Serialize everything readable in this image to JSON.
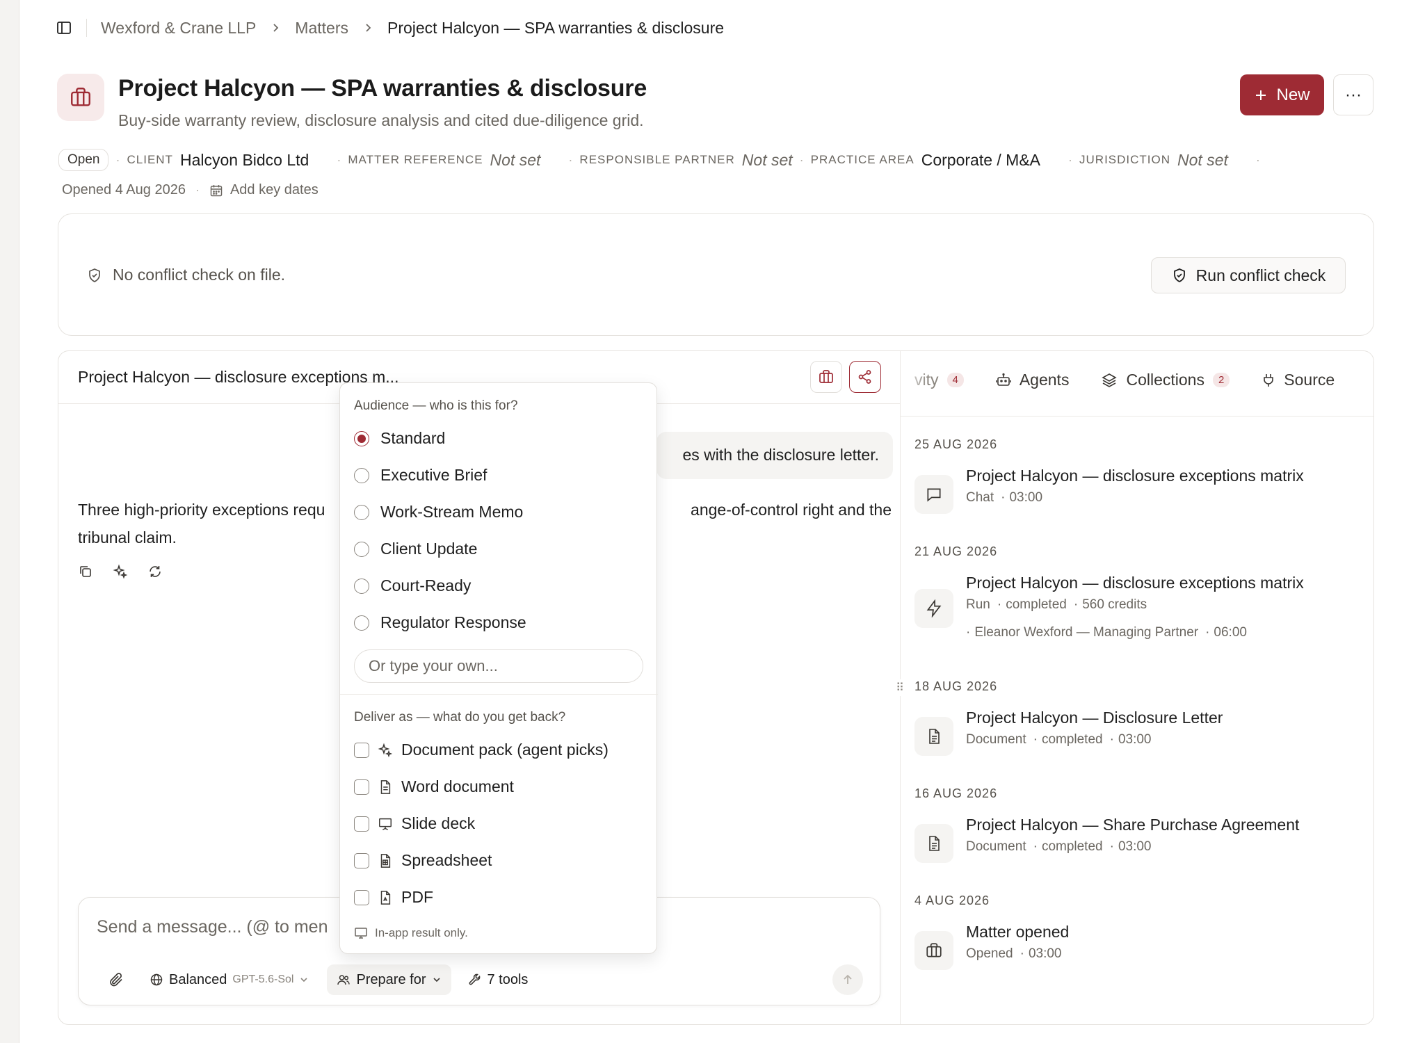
{
  "breadcrumb": {
    "firm": "Wexford & Crane LLP",
    "section": "Matters",
    "current": "Project Halcyon — SPA warranties & disclosure"
  },
  "header": {
    "title": "Project Halcyon — SPA warranties & disclosure",
    "subtitle": "Buy-side warranty review, disclosure analysis and cited due-diligence grid.",
    "new_label": "New",
    "more_label": "···"
  },
  "meta": {
    "status": "Open",
    "client_label": "CLIENT",
    "client_value": "Halcyon Bidco Ltd",
    "reference_label": "MATTER REFERENCE",
    "reference_value": "Not set",
    "partner_label": "RESPONSIBLE PARTNER",
    "partner_value": "Not set",
    "practice_label": "PRACTICE AREA",
    "practice_value": "Corporate / M&A",
    "jurisdiction_label": "JURISDICTION",
    "jurisdiction_value": "Not set",
    "opened": "Opened 4 Aug 2026",
    "key_dates": "Add key dates"
  },
  "conflict": {
    "text": "No conflict check on file.",
    "button": "Run conflict check"
  },
  "chat": {
    "title": "Project Halcyon — disclosure exceptions m...",
    "user_message": "es with the disclosure letter.",
    "assistant_line1_a": "Three high-priority exceptions requ",
    "assistant_line1_b": "ange-of-control right and the",
    "assistant_line2": "tribunal claim.",
    "composer_placeholder": "Send a message... (@ to men",
    "model_label": "Balanced",
    "model_sub": "GPT-5.6-Sol",
    "prepare_label": "Prepare for",
    "tools_label": "7 tools"
  },
  "side_tabs": [
    {
      "label": "vity",
      "badge": "4"
    },
    {
      "label": "Agents",
      "badge": ""
    },
    {
      "label": "Collections",
      "badge": "2"
    },
    {
      "label": "Source",
      "badge": ""
    }
  ],
  "timeline": [
    {
      "date": "25 AUG 2026",
      "title": "Project Halcyon — disclosure exceptions matrix",
      "meta": [
        "Chat",
        "03:00"
      ],
      "meta2": [],
      "icon": "chat-icon"
    },
    {
      "date": "21 AUG 2026",
      "title": "Project Halcyon — disclosure exceptions matrix",
      "meta": [
        "Run",
        "completed",
        "560 credits"
      ],
      "meta2": [
        "Eleanor Wexford — Managing Partner",
        "06:00"
      ],
      "icon": "bolt-icon"
    },
    {
      "date": "18 AUG 2026",
      "title": "Project Halcyon — Disclosure Letter",
      "meta": [
        "Document",
        "completed",
        "03:00"
      ],
      "meta2": [],
      "icon": "document-icon"
    },
    {
      "date": "16 AUG 2026",
      "title": "Project Halcyon — Share Purchase Agreement",
      "meta": [
        "Document",
        "completed",
        "03:00"
      ],
      "meta2": [],
      "icon": "document-icon"
    },
    {
      "date": "4 AUG 2026",
      "title": "Matter opened",
      "meta": [
        "Opened",
        "03:00"
      ],
      "meta2": [],
      "icon": "briefcase-icon"
    }
  ],
  "popover": {
    "audience_heading": "Audience — who is this for?",
    "audience_options": [
      "Standard",
      "Executive Brief",
      "Work-Stream Memo",
      "Client Update",
      "Court-Ready",
      "Regulator Response"
    ],
    "audience_selected": "Standard",
    "own_placeholder": "Or type your own...",
    "deliver_heading": "Deliver as — what do you get back?",
    "deliver_options": [
      "Document pack (agent picks)",
      "Word document",
      "Slide deck",
      "Spreadsheet",
      "PDF"
    ],
    "footer": "In-app result only."
  },
  "colors": {
    "accent": "#9e2b34",
    "accent_soft": "#f7eaea"
  }
}
